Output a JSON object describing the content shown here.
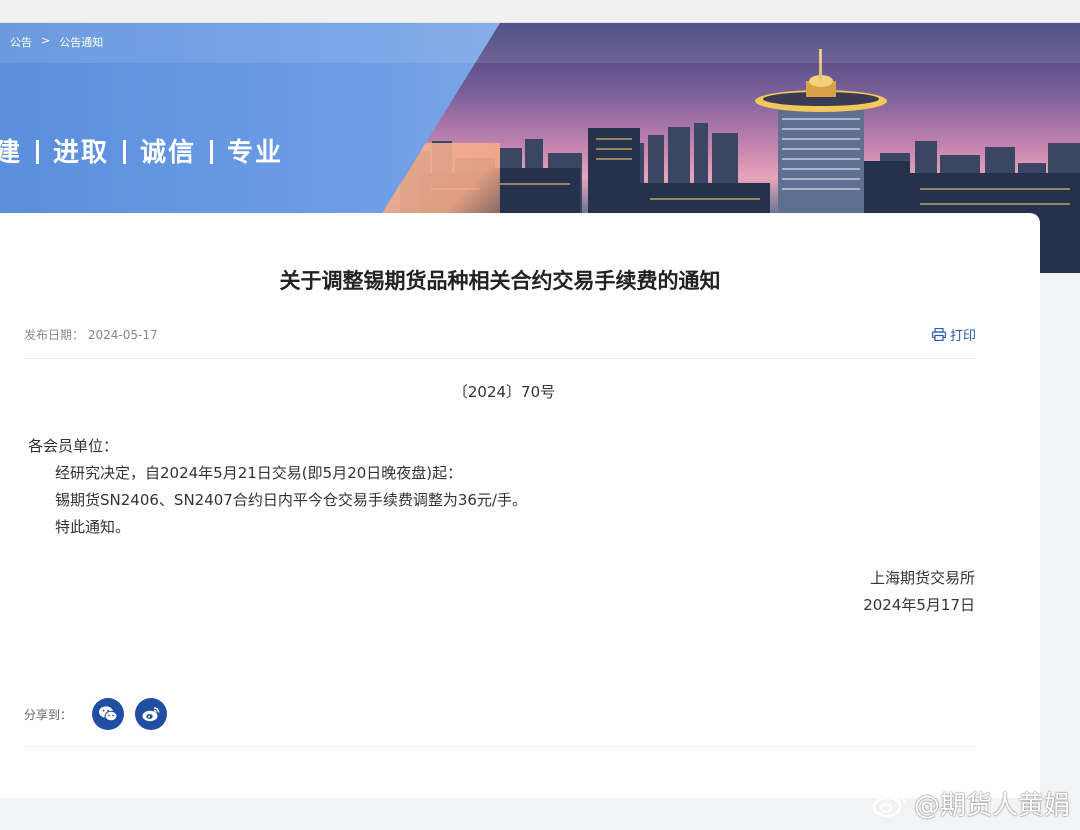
{
  "breadcrumb": [
    "公告",
    ">",
    "公告通知"
  ],
  "banner": {
    "slogan": [
      "建",
      "进取",
      "诚信",
      "专业"
    ]
  },
  "notice": {
    "title": "关于调整锡期货品种相关合约交易手续费的通知",
    "publish_label": "发布日期：",
    "publish_date": "2024-05-17",
    "print_label": "打印",
    "doc_number": "〔2024〕70号",
    "salutation": "各会员单位：",
    "paragraphs": [
      "经研究决定，自2024年5月21日交易(即5月20日晚夜盘)起：",
      "锡期货SN2406、SN2407合约日内平今仓交易手续费调整为36元/手。",
      "特此通知。"
    ],
    "issuer": "上海期货交易所",
    "issue_date": "2024年5月17日"
  },
  "share": {
    "label": "分享到：",
    "buttons": [
      {
        "icon": "wechat-icon"
      },
      {
        "icon": "weibo-icon"
      }
    ]
  },
  "watermark": "@期货人黄娟",
  "colors": {
    "accent": "#2a5caa",
    "share_button": "#1f4ea2",
    "banner_blue": "#5a8fdc"
  }
}
